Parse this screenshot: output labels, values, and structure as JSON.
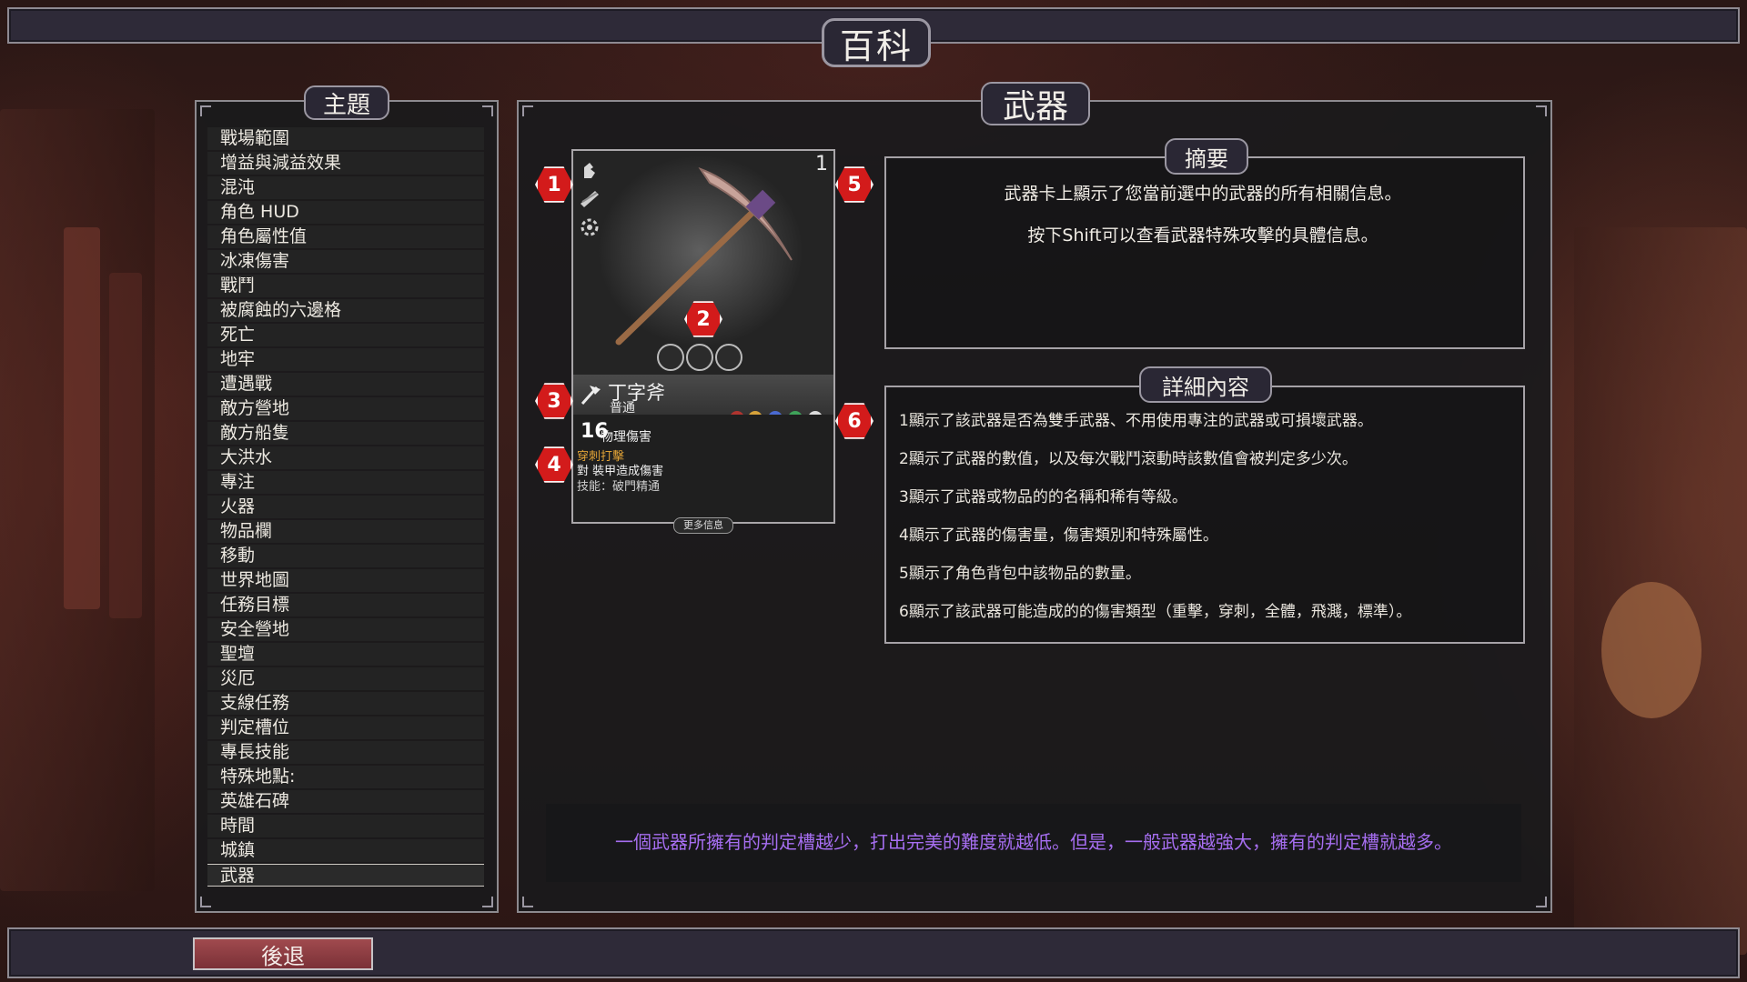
{
  "header": {
    "title": "百科"
  },
  "sidebar": {
    "title": "主題",
    "items": [
      "戰場範圍",
      "增益與減益效果",
      "混沌",
      "角色 HUD",
      "角色屬性值",
      "冰凍傷害",
      "戰鬥",
      "被腐蝕的六邊格",
      "死亡",
      "地牢",
      "遭遇戰",
      "敵方營地",
      "敵方船隻",
      "大洪水",
      "專注",
      "火器",
      "物品欄",
      "移動",
      "世界地圖",
      "任務目標",
      "安全營地",
      "聖壇",
      "災厄",
      "支線任務",
      "判定槽位",
      "專長技能",
      "特殊地點:",
      "英雄石碑",
      "時間",
      "城鎮",
      "武器"
    ],
    "selected_index": 30
  },
  "main": {
    "title": "武器",
    "card": {
      "count": "1",
      "name": "丁字斧",
      "rarity": "普通",
      "damage_value": "16",
      "damage_type": "物理傷害",
      "special_attack": "穿刺打擊",
      "special_desc": "對 裝甲造成傷害",
      "skill": "技能：破門精通",
      "more_button": "更多信息",
      "badges": [
        "1",
        "2",
        "3",
        "4",
        "5",
        "6"
      ]
    },
    "summary": {
      "title": "摘要",
      "lines": [
        "武器卡上顯示了您當前選中的武器的所有相關信息。",
        "按下Shift可以查看武器特殊攻擊的具體信息。"
      ]
    },
    "details": {
      "title": "詳細內容",
      "lines": [
        "1顯示了該武器是否為雙手武器、不用使用專注的武器或可損壞武器。",
        "2顯示了武器的數值，以及每次戰鬥滾動時該數值會被判定多少次。",
        "3顯示了武器或物品的的名稱和稀有等級。",
        "4顯示了武器的傷害量，傷害類別和特殊屬性。",
        "5顯示了角色背包中該物品的數量。",
        "6顯示了該武器可能造成的的傷害類型（重擊，穿刺，全體，飛濺，標準）。"
      ]
    },
    "hint": "一個武器所擁有的判定槽越少，打出完美的難度就越低。但是，一般武器越強大，擁有的判定槽就越多。"
  },
  "footer": {
    "back_label": "後退"
  },
  "colors": {
    "hint": "#a66ef0",
    "badge": "#d31b1b",
    "special": "#e0a236",
    "back_button": "#8d3c41"
  }
}
